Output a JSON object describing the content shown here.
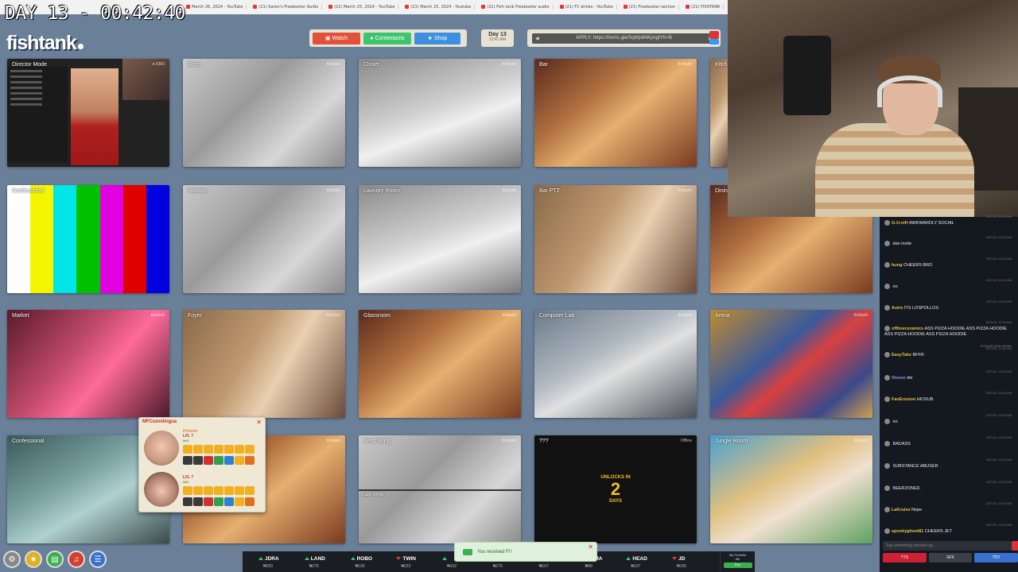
{
  "overlay": {
    "day_timer": "DAY 13 - 00:42:40"
  },
  "browser_tabs": [
    "March 26, 2024 - YouTube",
    "(21) Karen's Freebooter Audio",
    "(21) March 25, 2024 - YouTube",
    "(21) March 25, 2024 - Youtube",
    "(21) Fish tank Freebooter audio",
    "(21) F1 drinks - YouTube",
    "(21) Freebooter section",
    "(21) FISHTANK"
  ],
  "header": {
    "logo": "fishtank",
    "nav": {
      "watch": "Watch",
      "contestants": "Contestants",
      "shop": "Shop"
    },
    "day": {
      "title": "Day 13",
      "time": "12:41 AM"
    },
    "apply": {
      "text": "APPLY: https://forms.gle/SqWp6NKjmgfYN-f6"
    }
  },
  "cameras": [
    {
      "label": "Director Mode",
      "wm": "● 6360"
    },
    {
      "label": "Dorm",
      "wm": "fishtank"
    },
    {
      "label": "Closet",
      "wm": "fishtank"
    },
    {
      "label": "Bar",
      "wm": "fishtank"
    },
    {
      "label": "Kitchen",
      "wm": ""
    },
    {
      "label": "Confessional",
      "wm": ""
    },
    {
      "label": "Hallway",
      "wm": "fishtank"
    },
    {
      "label": "Laundry Room",
      "wm": "fishtank"
    },
    {
      "label": "Bar PTZ",
      "wm": "fishtank"
    },
    {
      "label": "Dining Room",
      "wm": ""
    },
    {
      "label": "Market",
      "wm": "fishtank"
    },
    {
      "label": "Foyer",
      "wm": "fishtank"
    },
    {
      "label": "Glassroom",
      "wm": "fishtank"
    },
    {
      "label": "Computer Lab",
      "wm": "fishtank"
    },
    {
      "label": "Arena",
      "wm": "fishtank"
    },
    {
      "label": "Confessional",
      "wm": ""
    },
    {
      "label": "",
      "wm": "fishtank"
    },
    {
      "label": "West Wing",
      "wm": "fishtank",
      "label2": "East Wing"
    },
    {
      "label": "???",
      "wm": "Offline"
    },
    {
      "label": "Jungle Room",
      "wm": "fishtank"
    }
  ],
  "unlock": {
    "line1": "UNLOCKS IN",
    "number": "2",
    "line2": "DAYS"
  },
  "color_bars": [
    "#ffffff",
    "#f5f500",
    "#00e5e5",
    "#00c000",
    "#e000e0",
    "#e00000",
    "#0000e0"
  ],
  "chat": {
    "messages": [
      {
        "user": "G-U-niH",
        "text": "AWKWARDLY SOCIAL",
        "time": "3/27/24, 12:42 AM",
        "color": "#e6c040"
      },
      {
        "user": "",
        "text": "dan invite",
        "time": "3/27/24, 12:42 AM",
        "color": "#e04040"
      },
      {
        "user": "hung",
        "text": "CHEERS BRO",
        "time": "3/27/24, 12:42 AM",
        "color": "#e6c040"
      },
      {
        "user": "",
        "text": "no",
        "time": "3/27/24, 12:42 AM",
        "color": "#aaaaaa"
      },
      {
        "user": "Astro",
        "text": "ITS LOSPOLLOS",
        "time": "3/27/24, 12:42 AM",
        "color": "#e6c040"
      },
      {
        "user": "offlineceramics",
        "text": "ASS PIZZA HOODIE ASS PIZZA HOODIE ASS PIZZA HOODIE ASS PIZZA HOODIE",
        "time": "3/27/24, 12:42 AM",
        "color": "#e6c040"
      },
      {
        "user": "EasyTake",
        "text": "BFFR",
        "time": "3/27/24, 12:42 AM",
        "color": "#e6c040"
      },
      {
        "user": "Steave",
        "text": "die",
        "time": "3/27/24, 12:42 AM",
        "color": "#6aa0e0"
      },
      {
        "user": "FanErosion",
        "text": "HICKUB",
        "time": "3/27/24, 12:42 AM",
        "color": "#e6c040"
      },
      {
        "user": "",
        "text": "no",
        "time": "3/27/24, 12:42 AM",
        "color": "#3a8a3a"
      },
      {
        "user": "",
        "text": "BADASS",
        "time": "3/27/24, 12:42 AM",
        "color": "#4a7ad0"
      },
      {
        "user": "",
        "text": "SUBSTANCE ABUSER",
        "time": "3/27/24, 12:42 AM",
        "color": "#d04040"
      },
      {
        "user": "",
        "text": "BEERZONED",
        "time": "3/27/24, 12:42 AM",
        "color": "#e06040"
      },
      {
        "user": "LaKruise",
        "text": "Nope",
        "time": "3/27/24, 12:42 AM",
        "color": "#e6c040"
      },
      {
        "user": "spookyghost81",
        "text": "CHEERS JET",
        "time": "3/27/24, 12:42 AM",
        "color": "#e6c040"
      }
    ],
    "system": "SYNCED BOD MODE",
    "input_placeholder": "Say something messed up...",
    "tools": {
      "tts": "TTS",
      "sfx": "SFX",
      "toy": "TOY"
    }
  },
  "popup": {
    "title": "MFCunnilingus",
    "rows": [
      {
        "name": "Prisoner",
        "level": "LVL 7",
        "money": "₦48"
      },
      {
        "name": "",
        "level": "LVL 7",
        "money": "₦58"
      }
    ]
  },
  "ticker": [
    {
      "name": "JDRA",
      "price": "₦200",
      "dir": "up"
    },
    {
      "name": "LAND",
      "price": "₦276",
      "dir": "up"
    },
    {
      "name": "ROBO",
      "price": "₦100",
      "dir": "up"
    },
    {
      "name": "TWIN",
      "price": "₦223",
      "dir": "down"
    },
    {
      "name": "",
      "price": "₦102",
      "dir": "up"
    },
    {
      "name": "",
      "price": "₦175",
      "dir": "up"
    },
    {
      "name": "",
      "price": "₦107",
      "dir": "up"
    },
    {
      "name": "EMMA",
      "price": "₦99",
      "dir": "down"
    },
    {
      "name": "HEAD",
      "price": "₦107",
      "dir": "up"
    },
    {
      "name": "JD",
      "price": "₦100",
      "dir": "down"
    }
  ],
  "portfolio": {
    "label": "My Portfolio",
    "value": "₦0",
    "button": "Buy"
  },
  "toast": {
    "text": "You received F!!"
  }
}
